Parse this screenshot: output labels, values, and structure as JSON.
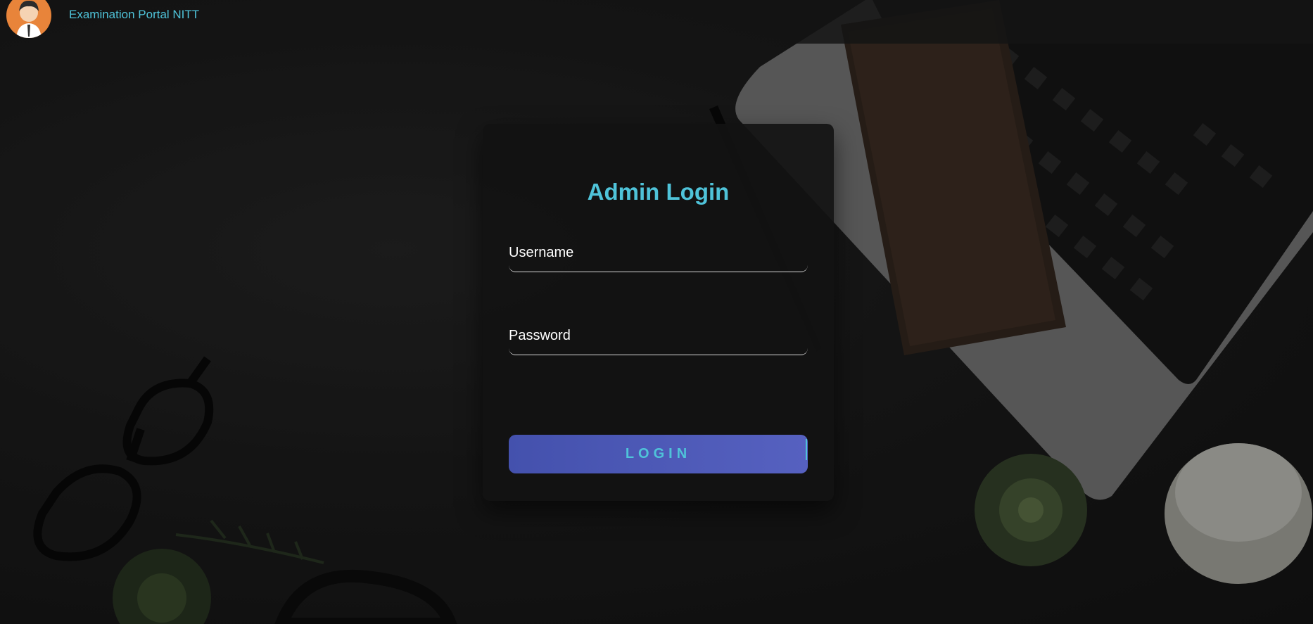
{
  "header": {
    "brand": "Examination Portal NITT"
  },
  "login_form": {
    "title": "Admin Login",
    "username_label": "Username",
    "password_label": "Password",
    "login_button": "LOGIN"
  },
  "colors": {
    "accent": "#4fc3d9",
    "button_start": "#4451ad",
    "button_end": "#5661c0",
    "avatar_bg": "#e8843a"
  }
}
